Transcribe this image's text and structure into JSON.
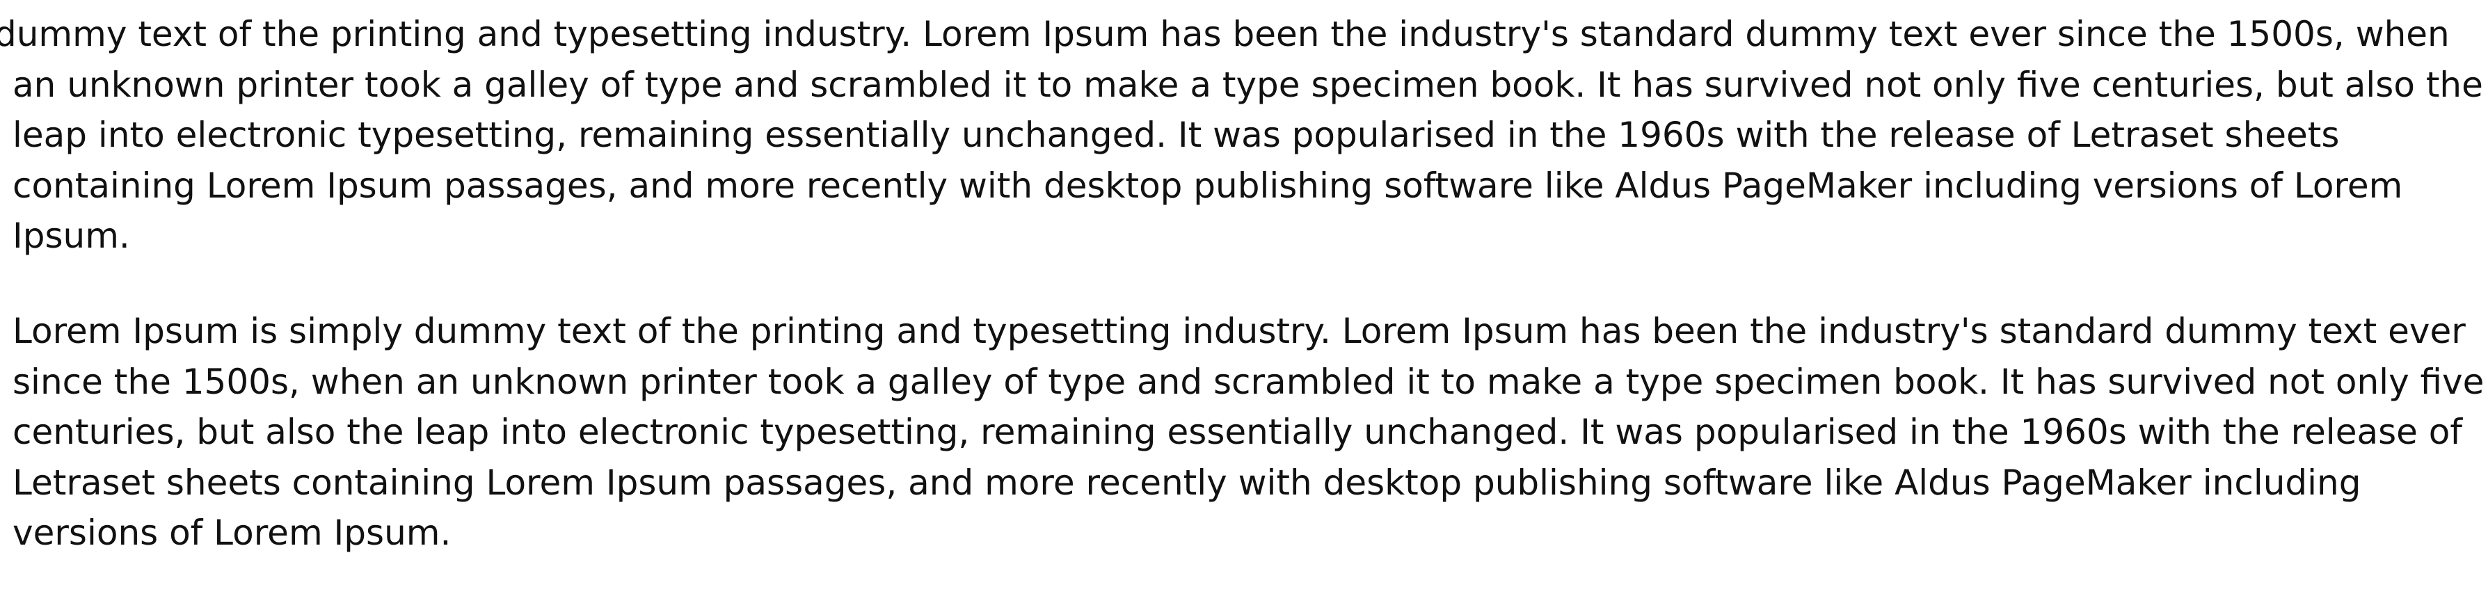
{
  "paragraphs": [
    {
      "lines": [
        "dummy text of the printing and typesetting industry. Lorem Ipsum has been the industry's standard dummy text ever since the 1500s, when",
        "an unknown printer took a galley of type and scrambled it to make a type specimen book. It has survived not only five centuries, but also the",
        "leap into electronic typesetting, remaining essentially unchanged. It was popularised in the 1960s with the release of Letraset sheets",
        "containing Lorem Ipsum passages, and more recently with desktop publishing software like Aldus PageMaker including versions of Lorem",
        "Ipsum."
      ]
    },
    {
      "lines": [
        "Lorem Ipsum is simply dummy text of the printing and typesetting industry. Lorem Ipsum has been the industry's standard dummy text ever",
        "since the 1500s, when an unknown printer took a galley of type and scrambled it to make a type specimen book. It has survived not only five",
        "centuries, but also the leap into electronic typesetting, remaining essentially unchanged. It was popularised in the 1960s with the release of",
        "Letraset sheets containing Lorem Ipsum passages, and more recently with desktop publishing software like Aldus PageMaker including",
        "versions of Lorem Ipsum."
      ]
    }
  ]
}
